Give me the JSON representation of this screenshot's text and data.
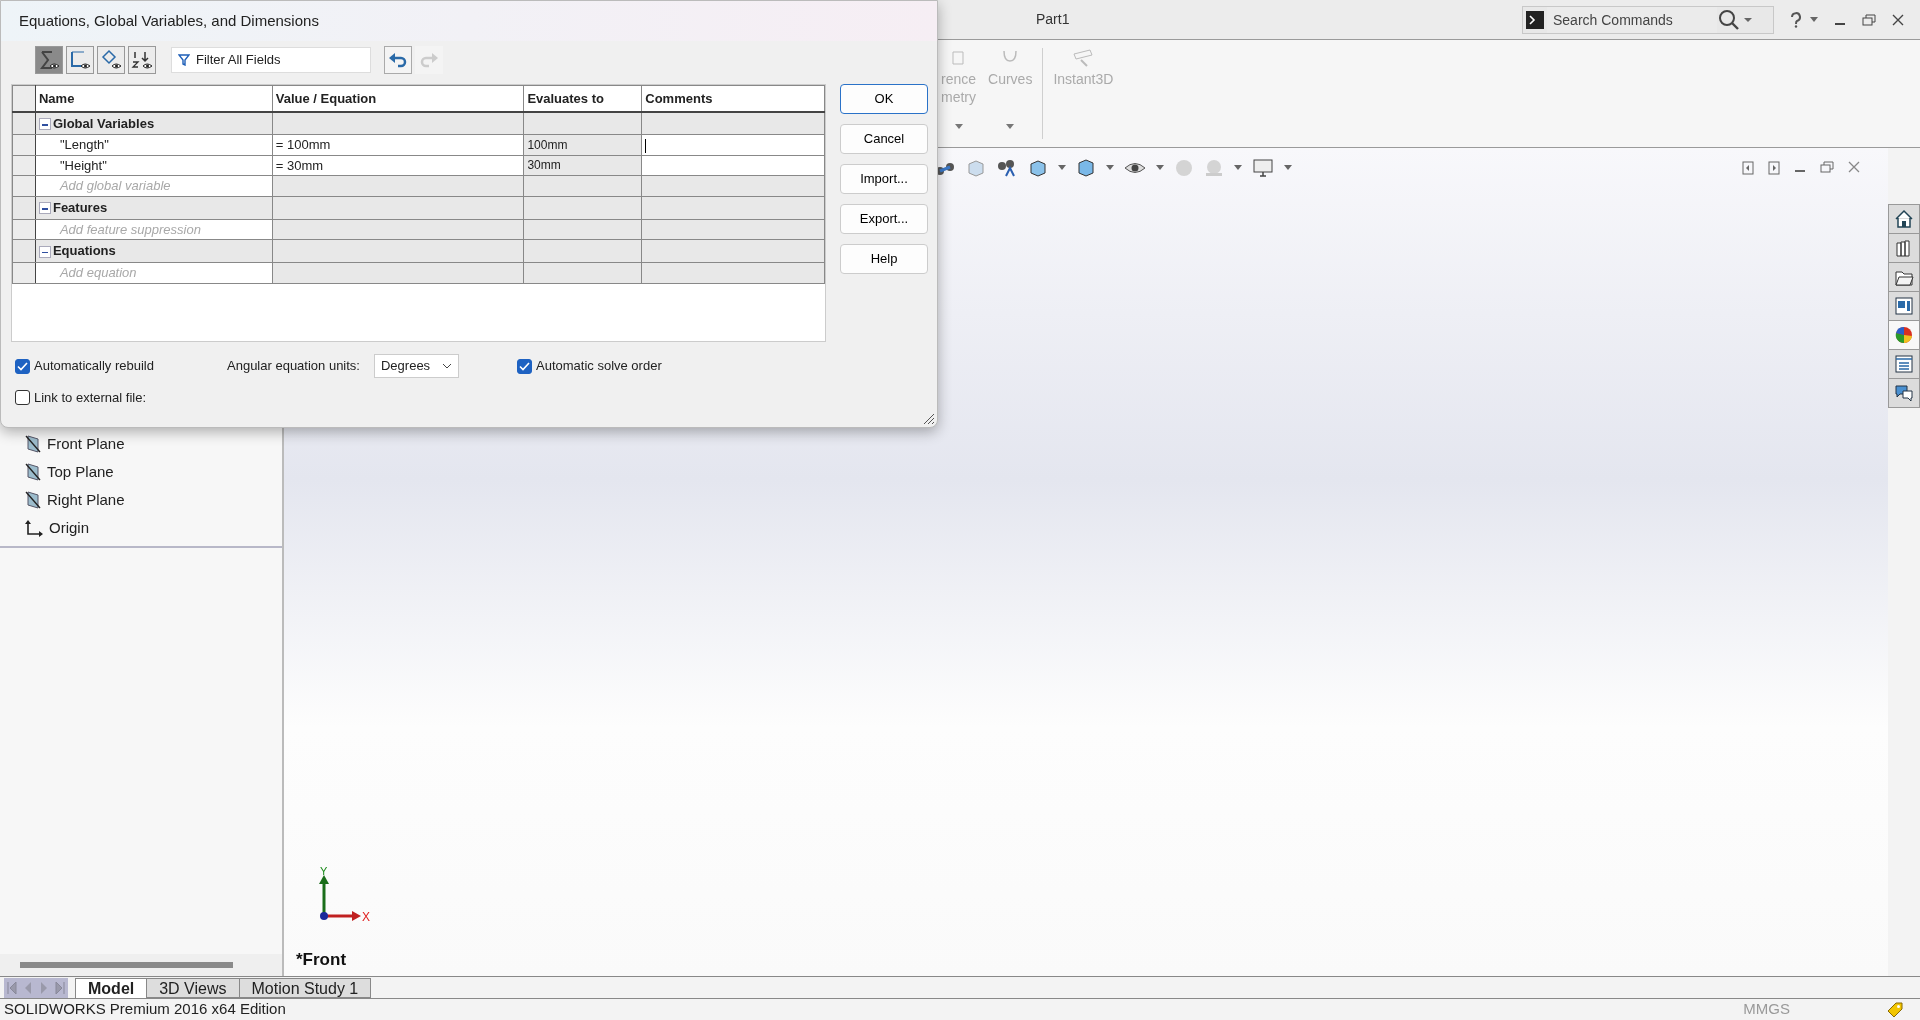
{
  "app": {
    "title": "Part1",
    "search": {
      "placeholder": "Search Commands"
    }
  },
  "ribbon": {
    "items": [
      {
        "lines": [
          "rence",
          "metry"
        ],
        "dropdown": true
      },
      {
        "lines": [
          "Curves"
        ],
        "dropdown": true
      },
      {
        "lines": [
          "Instant3D"
        ],
        "dropdown": false
      }
    ]
  },
  "feature_tree": {
    "items": [
      {
        "label": "Front Plane",
        "kind": "plane"
      },
      {
        "label": "Top Plane",
        "kind": "plane"
      },
      {
        "label": "Right Plane",
        "kind": "plane"
      },
      {
        "label": "Origin",
        "kind": "origin"
      }
    ]
  },
  "viewport": {
    "view_label": "*Front",
    "triad": {
      "x": "X",
      "y": "Y"
    }
  },
  "task_pane": {
    "tabs": [
      {
        "kind": "home",
        "selected": false
      },
      {
        "kind": "library",
        "selected": false
      },
      {
        "kind": "folder",
        "selected": false
      },
      {
        "kind": "palette",
        "selected": false
      },
      {
        "kind": "appearance",
        "selected": true
      },
      {
        "kind": "properties",
        "selected": false
      },
      {
        "kind": "forum",
        "selected": false
      }
    ]
  },
  "bottom_tabs": [
    {
      "label": "Model",
      "selected": true
    },
    {
      "label": "3D Views",
      "selected": false
    },
    {
      "label": "Motion Study 1",
      "selected": false
    }
  ],
  "status_bar": {
    "edition": "SOLIDWORKS Premium 2016 x64 Edition",
    "units": "MMGS"
  },
  "dialog": {
    "title": "Equations, Global Variables, and Dimensions",
    "view_buttons": [
      {
        "kind": "equations",
        "selected": true
      },
      {
        "kind": "sketch",
        "selected": false
      },
      {
        "kind": "dimensions",
        "selected": false
      },
      {
        "kind": "ordered",
        "selected": false
      }
    ],
    "filter": {
      "placeholder": "Filter All Fields"
    },
    "columns": [
      "Name",
      "Value / Equation",
      "Evaluates to",
      "Comments"
    ],
    "sections": [
      {
        "title": "Global Variables",
        "expanded": true,
        "rows": [
          {
            "name": "\"Length\"",
            "value": "= 100mm",
            "evaluates_to": "100mm"
          },
          {
            "name": "\"Height\"",
            "value": "= 30mm",
            "evaluates_to": "30mm"
          }
        ],
        "add_placeholder": "Add global variable"
      },
      {
        "title": "Features",
        "expanded": true,
        "add_placeholder": "Add feature suppression"
      },
      {
        "title": "Equations",
        "expanded": true,
        "add_placeholder": "Add equation"
      }
    ],
    "buttons": [
      "OK",
      "Cancel",
      "Import...",
      "Export...",
      "Help"
    ],
    "auto_rebuild": {
      "label": "Automatically rebuild",
      "checked": true
    },
    "angular_units": {
      "label": "Angular equation units:",
      "value": "Degrees"
    },
    "auto_solve_order": {
      "label": "Automatic solve order",
      "checked": true
    },
    "link_external": {
      "label": "Link to external file:",
      "checked": false
    }
  }
}
